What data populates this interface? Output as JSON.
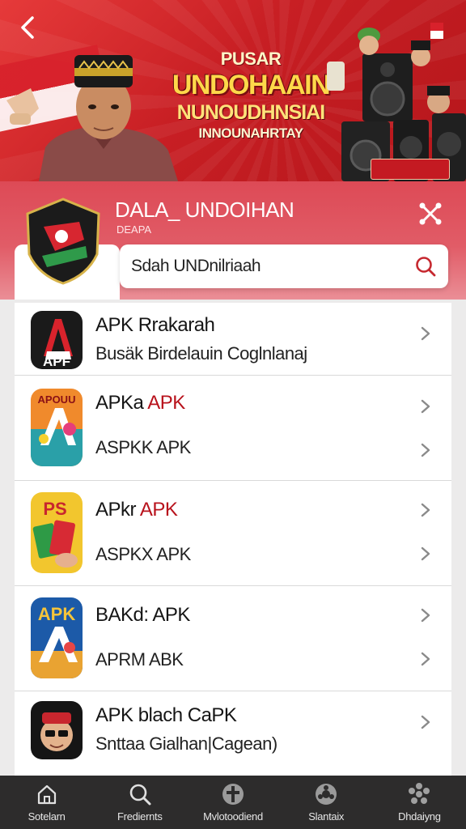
{
  "banner": {
    "line1": "PUSAR",
    "line2": "UNDOHAAIN",
    "line3": "NUNOUDHNSIAI",
    "line4": "INNOUNAHRTAY"
  },
  "header": {
    "title": "DALA_ UNDOIHAN",
    "subtitle": "DEAPA"
  },
  "search": {
    "value": "Sdah UNDnilriaah"
  },
  "list": [
    {
      "line1": "APK Rrakarah",
      "line2": "Busäk Birdelauin Coglnlanaj"
    },
    {
      "line1_prefix": "APKa ",
      "line1_accent": "APK",
      "line2": "ASPKK APK"
    },
    {
      "line1_prefix": "APkr ",
      "line1_accent": "APK",
      "line2": "ASPKX APK"
    },
    {
      "line1": "BAKd: APK",
      "line2": "APRM ABK"
    },
    {
      "line1": "APK blach CaPK",
      "line2": "Snttaa Gialhan|Cagean)"
    }
  ],
  "icons": {
    "item1": {
      "text": "APF"
    },
    "item2": {
      "text": "APOUU"
    },
    "item3": {
      "text": "PS"
    },
    "item4": {
      "text": "APK"
    }
  },
  "nav": [
    {
      "label": "Sotelarn",
      "icon": "home-icon"
    },
    {
      "label": "Frediernts",
      "icon": "search-icon"
    },
    {
      "label": "Mvlotoodiend",
      "icon": "cross-icon"
    },
    {
      "label": "Slantaix",
      "icon": "settings-icon"
    },
    {
      "label": "Dhdaiyng",
      "icon": "apps-icon"
    }
  ],
  "colors": {
    "accent": "#b8121c",
    "header": "#dd4a56",
    "nav": "#2d2c2c"
  }
}
